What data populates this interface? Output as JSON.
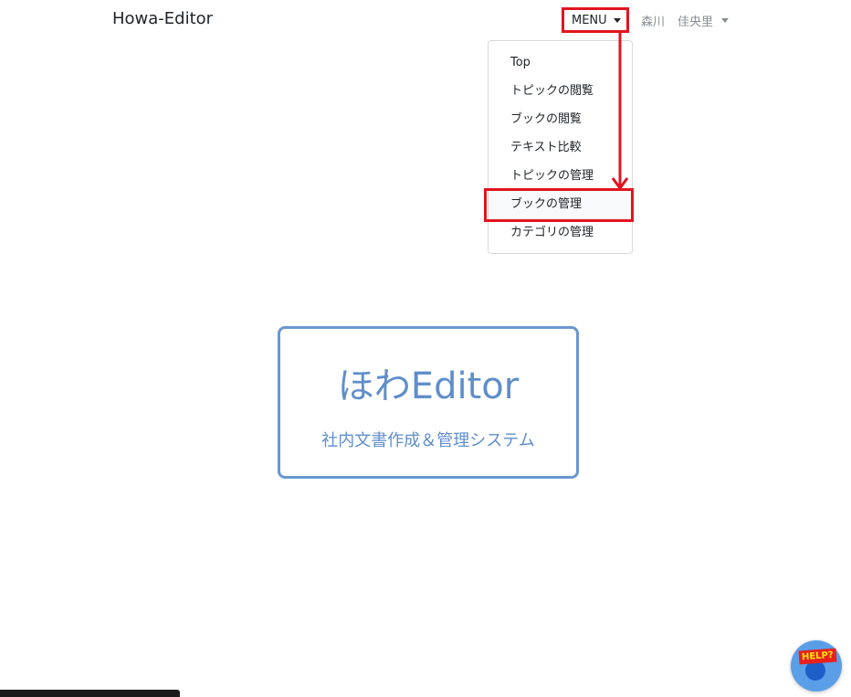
{
  "navbar": {
    "brand": "Howa-Editor",
    "menu_label": "MENU",
    "user_last": "森川",
    "user_first": "佳央里"
  },
  "menu": {
    "items": [
      {
        "label": "Top"
      },
      {
        "label": "トピックの閲覧"
      },
      {
        "label": "ブックの閲覧"
      },
      {
        "label": "テキスト比較"
      },
      {
        "label": "トピックの管理"
      },
      {
        "label": "ブックの管理"
      },
      {
        "label": "カテゴリの管理"
      }
    ],
    "highlighted_item": "ブックの管理"
  },
  "hero": {
    "title": "ほわEditor",
    "subtitle": "社内文書作成＆管理システム"
  },
  "help": {
    "badge": "HELP?"
  },
  "colors": {
    "annotation": "#e0151f",
    "hero_accent": "#5f8fca",
    "help_button": "#5a9ee8"
  }
}
